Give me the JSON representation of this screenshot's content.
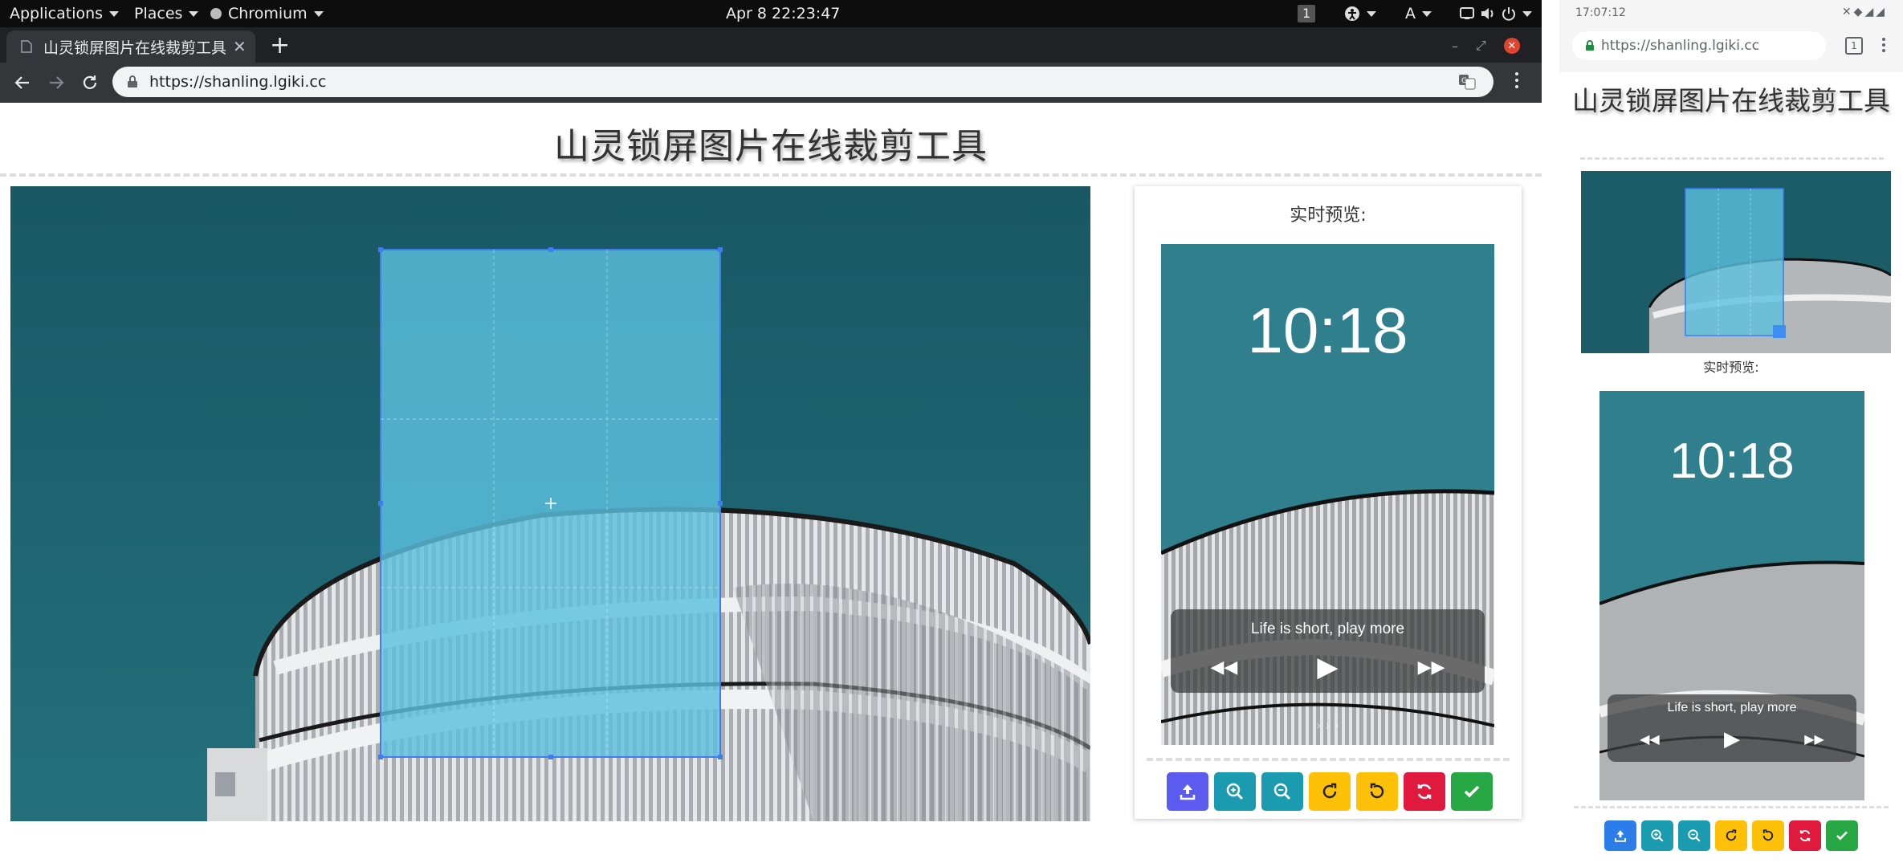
{
  "system_bar": {
    "applications": "Applications",
    "places": "Places",
    "chromium": "Chromium",
    "clock": "Apr 8  22:23:47",
    "workspace": "1",
    "input_method": "A"
  },
  "browser": {
    "tab_title": "山灵锁屏图片在线裁剪工具",
    "url": "https://shanling.lgiki.cc"
  },
  "page": {
    "title": "山灵锁屏图片在线裁剪工具",
    "preview_label": "实时预览:",
    "preview_clock": "10:18",
    "preview_song": "Life is short, play more",
    "preview_hint": "› › ›"
  },
  "toolbar_buttons": [
    {
      "name": "upload",
      "color": "#5b5bf0",
      "icon": "upload-icon"
    },
    {
      "name": "zoom-in",
      "color": "#1a9bb0",
      "icon": "zoom-in-icon"
    },
    {
      "name": "zoom-out",
      "color": "#1a9bb0",
      "icon": "zoom-out-icon"
    },
    {
      "name": "rotate-right",
      "color": "#ffc107",
      "icon": "rotate-cw-icon"
    },
    {
      "name": "rotate-left",
      "color": "#ffc107",
      "icon": "rotate-ccw-icon"
    },
    {
      "name": "reset",
      "color": "#e0193e",
      "icon": "refresh-icon"
    },
    {
      "name": "confirm",
      "color": "#28a745",
      "icon": "check-icon"
    }
  ],
  "phone": {
    "time": "17:07:12",
    "url": "https://shanling.lgiki.cc",
    "tab_count": "1",
    "title": "山灵锁屏图片在线裁剪工具",
    "preview_label": "实时预览:",
    "preview_clock": "10:18",
    "preview_song": "Life is short, play more"
  },
  "colors": {
    "sky": "#1e5e68",
    "crop_overlay": "#5bc0de",
    "crop_border": "#3d7df0"
  }
}
